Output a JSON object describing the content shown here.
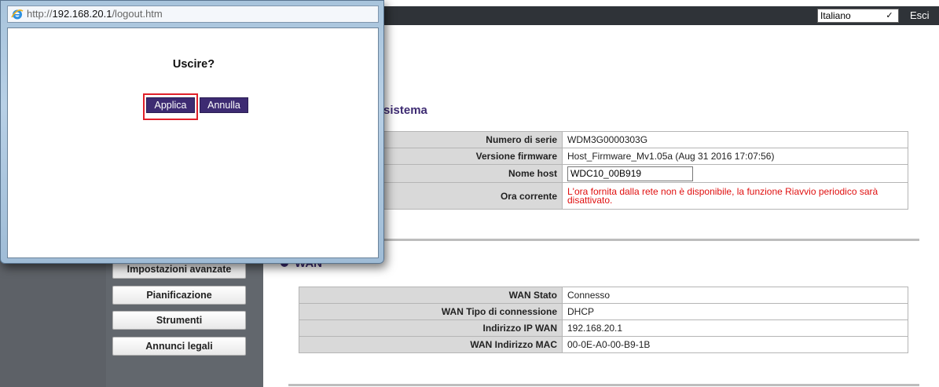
{
  "popup": {
    "url_prefix": "http://",
    "url_host": "192.168.20.1",
    "url_path": "/logout.htm",
    "question": "Uscire?",
    "apply_label": "Applica",
    "cancel_label": "Annulla"
  },
  "header": {
    "language_selected": "Italiano",
    "logout_label": "Esci"
  },
  "nav": {
    "items": [
      {
        "label": "Impostazioni avanzate"
      },
      {
        "label": "Pianificazione"
      },
      {
        "label": "Strumenti"
      },
      {
        "label": "Annunci legali"
      }
    ]
  },
  "system": {
    "title": "sistema",
    "rows": [
      {
        "label": "Numero di serie",
        "value": "WDM3G0000303G"
      },
      {
        "label": "Versione firmware",
        "value": "Host_Firmware_Mv1.05a (Aug 31 2016 17:07:56)"
      },
      {
        "label": "Nome host",
        "value": "WDC10_00B919"
      },
      {
        "label": "Ora corrente",
        "value": "L'ora fornita dalla rete non è disponibile, la funzione Riavvio periodico sarà disattivato."
      }
    ]
  },
  "wan": {
    "title": "WAN",
    "rows": [
      {
        "label": "WAN Stato",
        "value": "Connesso"
      },
      {
        "label": "WAN Tipo di connessione",
        "value": "DHCP"
      },
      {
        "label": "Indirizzo IP WAN",
        "value": "192.168.20.1"
      },
      {
        "label": "WAN Indirizzo MAC",
        "value": "00-0E-A0-00-B9-1B"
      }
    ]
  },
  "colors": {
    "accent": "#3d2b72",
    "topbar": "#2f3338",
    "warning": "#e01010",
    "highlight": "#e0202a"
  }
}
